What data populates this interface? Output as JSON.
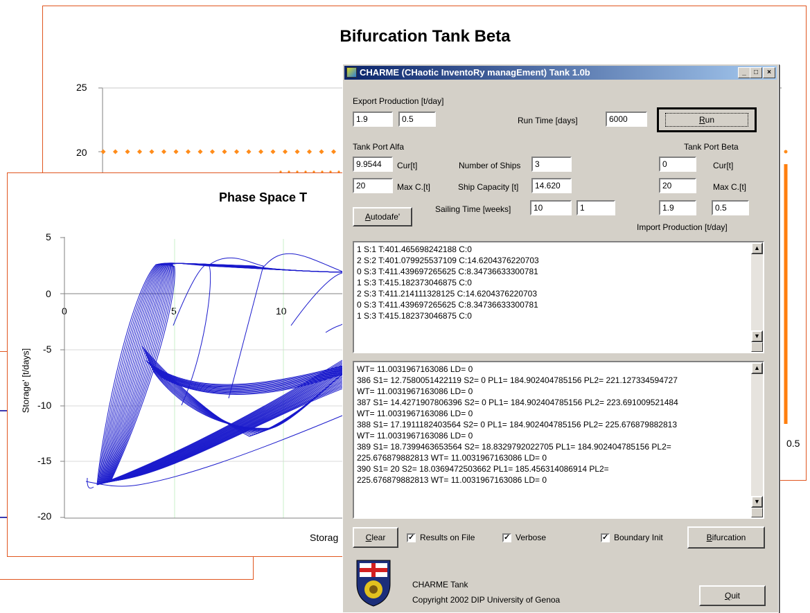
{
  "bifurcation_chart": {
    "title": "Bifurcation Tank Beta",
    "y_ticks": [
      "25",
      "20"
    ],
    "x_tick_right": "0.5",
    "colors": {
      "frame": "#e0551e",
      "series": "#ff8c1a"
    }
  },
  "phase_chart": {
    "title": "Phase Space T",
    "ylabel": "Storage' [t/days]",
    "xlabel": "Storag",
    "y_ticks": [
      "5",
      "0",
      "-5",
      "-10",
      "-15",
      "-20"
    ],
    "x_ticks": [
      "0",
      "5",
      "10"
    ],
    "colors": {
      "frame": "#e0551e",
      "series": "#1a1acc"
    }
  },
  "dialog": {
    "title": "CHARME (CHaotic InventoRy managEment) Tank 1.0b",
    "window_buttons": {
      "minimize": "_",
      "maximize": "□",
      "close": "×"
    },
    "export_production_label": "Export Production [t/day]",
    "export_production_1": "1.9",
    "export_production_2": "0.5",
    "run_time_label": "Run Time [days]",
    "run_time_value": "6000",
    "run_button": "Run",
    "tank_alfa_label": "Tank Port Alfa",
    "alfa_cur": "9.9544",
    "alfa_cur_label": "Cur[t]",
    "alfa_max": "20",
    "alfa_max_label": "Max C.[t]",
    "ships_label": "Number of Ships",
    "ships_value": "3",
    "capacity_label": "Ship Capacity [t]",
    "capacity_value": "14.620",
    "tank_beta_label": "Tank Port Beta",
    "beta_cur": "0",
    "beta_cur_label": "Cur[t]",
    "beta_max": "20",
    "beta_max_label": "Max C.[t]",
    "autodafe_button": "Autodafe'",
    "sailing_label": "Sailing Time [weeks]",
    "sailing_1": "10",
    "sailing_2": "1",
    "import_1": "1.9",
    "import_2": "0.5",
    "import_label": "Import Production [t/day]",
    "log1": [
      "1 S:1 T:401.465698242188 C:0",
      "2 S:2 T:401.079925537109 C:14.6204376220703",
      "0 S:3 T:411.439697265625 C:8.34736633300781",
      "1 S:3 T:415.182373046875 C:0",
      "2 S:3 T:411.214111328125 C:14.6204376220703",
      "0 S:3 T:411.439697265625 C:8.34736633300781",
      "1 S:3 T:415.182373046875 C:0"
    ],
    "log2": [
      "WT= 11.0031967163086 LD= 0",
      "386 S1= 12.7580051422119 S2= 0 PL1= 184.902404785156 PL2= 221.127334594727",
      "WT= 11.0031967163086 LD= 0",
      "387 S1= 14.4271907806396 S2= 0 PL1= 184.902404785156 PL2= 223.691009521484",
      "WT= 11.0031967163086 LD= 0",
      "388 S1= 17.1911182403564 S2= 0 PL1= 184.902404785156 PL2= 225.676879882813",
      "WT= 11.0031967163086 LD= 0",
      "389 S1= 18.7399463653564 S2= 18.8329792022705 PL1= 184.902404785156 PL2=",
      "225.676879882813 WT= 11.0031967163086 LD= 0",
      "390 S1= 20 S2= 18.0369472503662 PL1= 185.456314086914 PL2=",
      "225.676879882813 WT= 11.0031967163086 LD= 0"
    ],
    "clear_button": "Clear",
    "results_on_file_label": "Results on File",
    "verbose_label": "Verbose",
    "boundary_init_label": "Boundary Init",
    "bifurcation_button": "Bifurcation",
    "footer_line1": "CHARME Tank",
    "footer_line2": "Copyright 2002 DIP University of Genoa",
    "quit_button": "Quit",
    "checkmark": "✓"
  }
}
